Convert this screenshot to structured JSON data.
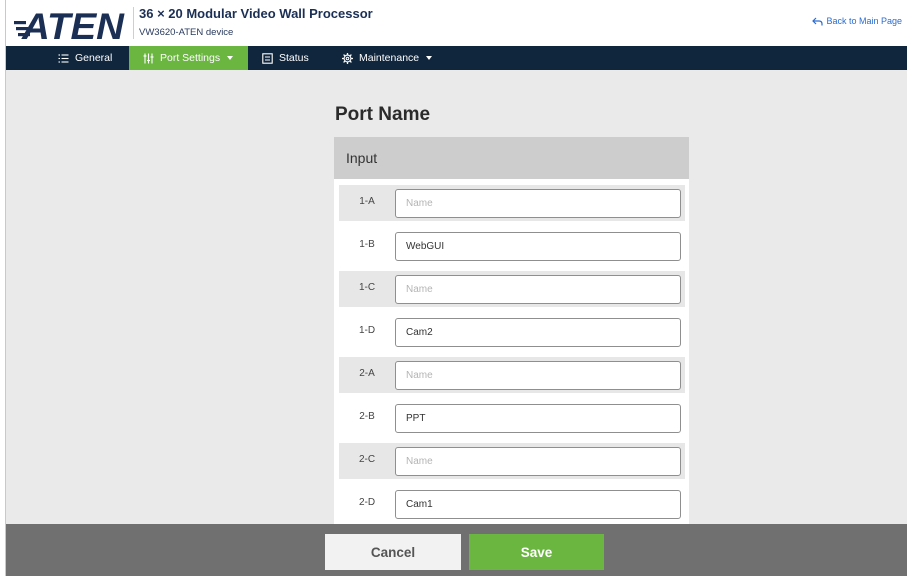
{
  "header": {
    "logo_text": "ATEN",
    "title": "36 × 20 Modular Video Wall Processor",
    "subtitle": "VW3620-ATEN device",
    "back_link": "Back to Main Page"
  },
  "nav": {
    "items": [
      {
        "label": "General",
        "icon": "list-icon"
      },
      {
        "label": "Port Settings",
        "icon": "sliders-icon",
        "active": true,
        "dropdown": true
      },
      {
        "label": "Status",
        "icon": "status-icon"
      },
      {
        "label": "Maintenance",
        "icon": "gear-icon",
        "dropdown": true
      }
    ]
  },
  "main": {
    "title": "Port Name",
    "section_label": "Input",
    "ports": [
      {
        "id": "1-A",
        "value": "",
        "placeholder": "Name"
      },
      {
        "id": "1-B",
        "value": "WebGUI",
        "placeholder": "Name"
      },
      {
        "id": "1-C",
        "value": "",
        "placeholder": "Name"
      },
      {
        "id": "1-D",
        "value": "Cam2",
        "placeholder": "Name"
      },
      {
        "id": "2-A",
        "value": "",
        "placeholder": "Name"
      },
      {
        "id": "2-B",
        "value": "PPT",
        "placeholder": "Name"
      },
      {
        "id": "2-C",
        "value": "",
        "placeholder": "Name"
      },
      {
        "id": "2-D",
        "value": "Cam1",
        "placeholder": "Name"
      }
    ]
  },
  "footer": {
    "cancel_label": "Cancel",
    "save_label": "Save"
  },
  "colors": {
    "nav_background": "#10263d",
    "accent_green": "#6bb541",
    "footer_background": "#707070",
    "title_color": "#1b2f55",
    "link_color": "#2a6cd1"
  }
}
